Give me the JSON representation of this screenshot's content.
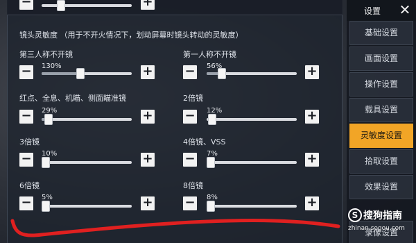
{
  "header": {
    "title": "设置",
    "close_icon": "close-icon"
  },
  "sidebar": {
    "items": [
      {
        "label": "基础设置",
        "active": false
      },
      {
        "label": "画面设置",
        "active": false
      },
      {
        "label": "操作设置",
        "active": false
      },
      {
        "label": "载具设置",
        "active": false
      },
      {
        "label": "灵敏度设置",
        "active": true
      },
      {
        "label": "拾取设置",
        "active": false
      },
      {
        "label": "效果设置",
        "active": false
      },
      {
        "label": "录像设置",
        "active": false
      }
    ]
  },
  "section": {
    "title": "镜头灵敏度  （用于不开火情况下，划动屏幕时镜头转动的灵敏度）"
  },
  "sliders": {
    "third_person": {
      "label": "第三人称不开镜",
      "value": "130%",
      "fraction": 0.43
    },
    "first_person": {
      "label": "第一人称不开镜",
      "value": "56%",
      "fraction": 0.18
    },
    "red_dot": {
      "label": "红点、全息、机瞄、侧面瞄准镜",
      "value": "29%",
      "fraction": 0.06
    },
    "scope_2x": {
      "label": "2倍镜",
      "value": "12%",
      "fraction": 0.03
    },
    "scope_3x": {
      "label": "3倍镜",
      "value": "10%",
      "fraction": 0.02
    },
    "scope_4x": {
      "label": "4倍镜、VSS",
      "value": "7%",
      "fraction": 0.01
    },
    "scope_6x": {
      "label": "6倍镜",
      "value": "5%",
      "fraction": 0.01
    },
    "scope_8x": {
      "label": "8倍镜",
      "value": "8%",
      "fraction": 0.01
    }
  },
  "buttons": {
    "minus": "−",
    "plus": "+"
  },
  "watermark": {
    "logo": "S",
    "text": "搜狗指南",
    "url": "zhinan.sogou.com"
  },
  "colors": {
    "accent": "#f2a526",
    "annotation": "#e02020"
  }
}
